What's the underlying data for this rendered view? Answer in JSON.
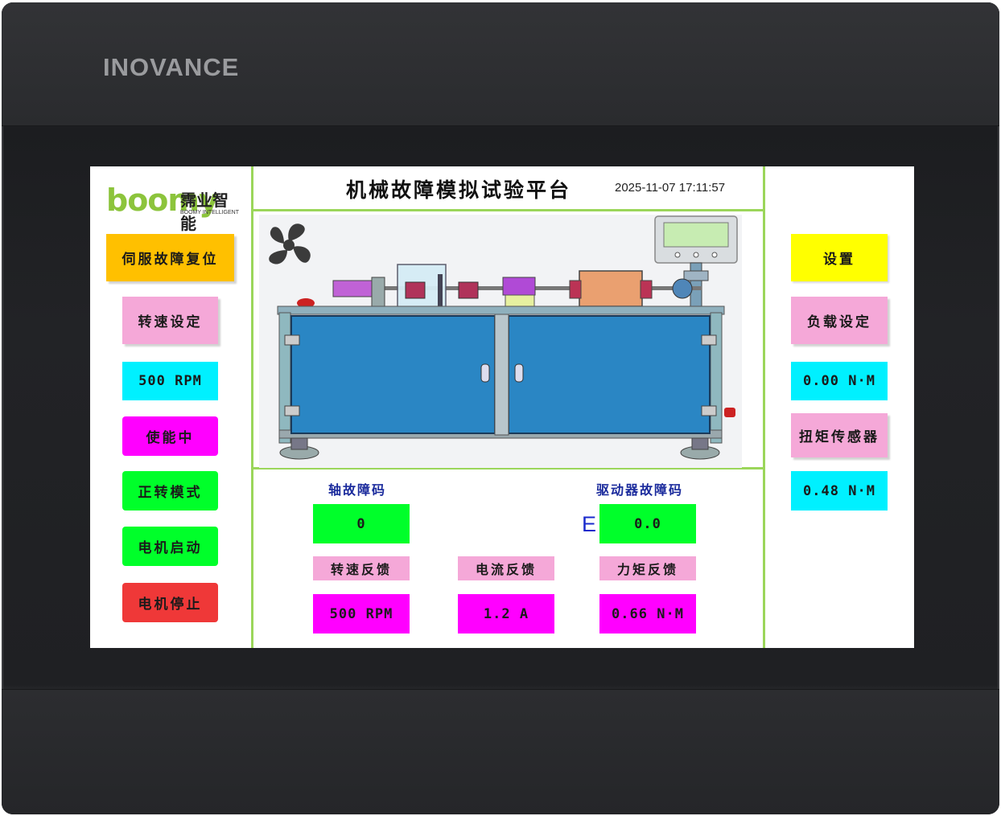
{
  "device": {
    "brand": "INOVANCE"
  },
  "logo": {
    "text": "boomy",
    "cn": "霈业智能",
    "en": "BOOMY INTELLIGENT"
  },
  "header": {
    "title": "机械故障模拟试验平台",
    "datetime": "2025-11-07 17:11:57"
  },
  "left_panel": {
    "servo_reset": "伺服故障复位",
    "speed_set": "转速设定",
    "speed_value": "500 RPM",
    "enable_status": "使能中",
    "forward_mode": "正转模式",
    "motor_start": "电机启动",
    "motor_stop": "电机停止"
  },
  "right_panel": {
    "settings": "设置",
    "load_set": "负载设定",
    "load_value": "0.00 N·M",
    "torque_sensor": "扭矩传感器",
    "torque_value": "0.48 N·M"
  },
  "status": {
    "axis_fault_label": "轴故障码",
    "axis_fault_value": "0",
    "driver_fault_label": "驱动器故障码",
    "driver_fault_prefix": "E",
    "driver_fault_value": "0.0",
    "speed_fb_label": "转速反馈",
    "speed_fb_value": "500 RPM",
    "current_fb_label": "电流反馈",
    "current_fb_value": "1.2 A",
    "torque_fb_label": "力矩反馈",
    "torque_fb_value": "0.66 N·M"
  },
  "colors": {
    "green": "#00ff2a",
    "magenta": "#ff00ff",
    "cyan": "#00f0ff",
    "yellow": "#ffff00",
    "orange": "#ffc000",
    "pink": "#f5a8d8",
    "red": "#ef3838",
    "divider": "#9bd65a",
    "cabinet": "#2a86c4"
  }
}
